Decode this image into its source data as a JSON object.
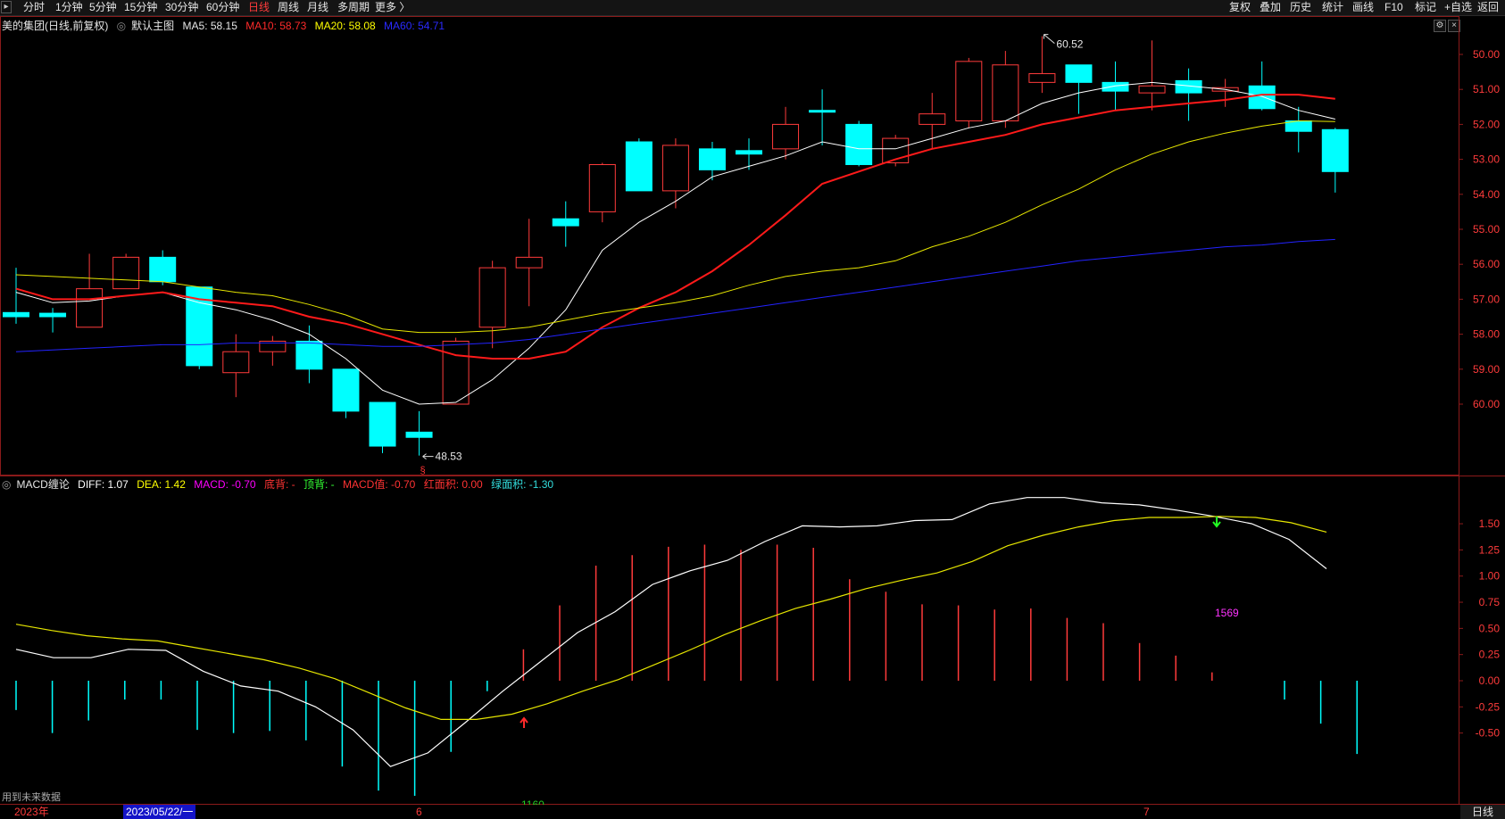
{
  "toolbar": {
    "left": [
      {
        "label": "分时",
        "active": false
      },
      {
        "label": "1分钟",
        "active": false
      },
      {
        "label": "5分钟",
        "active": false
      },
      {
        "label": "15分钟",
        "active": false
      },
      {
        "label": "30分钟",
        "active": false
      },
      {
        "label": "60分钟",
        "active": false
      },
      {
        "label": "日线",
        "active": true
      },
      {
        "label": "周线",
        "active": false
      },
      {
        "label": "月线",
        "active": false
      },
      {
        "label": "多周期",
        "active": false
      },
      {
        "label": "更多 〉",
        "active": false
      }
    ],
    "right": [
      "复权",
      "叠加",
      "历史",
      "统计",
      "画线",
      "F10",
      "标记",
      "+自选",
      "返回"
    ]
  },
  "main": {
    "title": "美的集团(日线,前复权)",
    "template": "默认主图",
    "ma5": "MA5: 58.15",
    "ma10": "MA10: 58.73",
    "ma20": "MA20: 58.08",
    "ma60": "MA60: 54.71",
    "high_label": "60.52",
    "low_label": "48.53",
    "low_marker": "§",
    "y_ticks": [
      "60.00",
      "59.00",
      "58.00",
      "57.00",
      "56.00",
      "55.00",
      "54.00",
      "53.00",
      "52.00",
      "51.00",
      "50.00"
    ]
  },
  "macd": {
    "name": "MACD缠论",
    "diff": "DIFF: 1.07",
    "dea": "DEA: 1.42",
    "macd": "MACD: -0.70",
    "bottom_div": "底背: -",
    "top_div": "顶背: -",
    "macd_value": "MACD值: -0.70",
    "red_area": "红面积: 0.00",
    "green_area": "绿面积: -1.30",
    "label_1569": "1569",
    "label_1160": "1160",
    "y_ticks": [
      "1.50",
      "1.25",
      "1.00",
      "0.75",
      "0.50",
      "0.25",
      "0.00",
      "-0.25",
      "-0.50"
    ]
  },
  "bottom": {
    "future_note": "用到未来数据",
    "year": "2023年",
    "cursor_date": "2023/05/22/一",
    "month6": "6",
    "month7": "7",
    "period_button": "日线"
  },
  "colors": {
    "up": "#ff3b3b",
    "down": "#00ffff",
    "ma5": "#ffffff",
    "ma10": "#ff1a1a",
    "ma20": "#e6e600",
    "ma60": "#2323ff",
    "diff": "#ffffff",
    "dea": "#e6e600"
  },
  "chart_data": [
    {
      "type": "candlestick",
      "title": "美的集团(日线,前复权)",
      "ylim": [
        49.5,
        60.6
      ],
      "y_ticks": [
        50,
        51,
        52,
        53,
        54,
        55,
        56,
        57,
        58,
        59,
        60
      ],
      "candles": [
        {
          "o": 52.62,
          "h": 53.9,
          "l": 52.3,
          "c": 52.5
        },
        {
          "o": 52.6,
          "h": 52.75,
          "l": 52.05,
          "c": 52.5
        },
        {
          "o": 52.2,
          "h": 54.3,
          "l": 52.2,
          "c": 53.3
        },
        {
          "o": 53.3,
          "h": 54.3,
          "l": 53.3,
          "c": 54.2
        },
        {
          "o": 54.2,
          "h": 54.4,
          "l": 53.4,
          "c": 53.5
        },
        {
          "o": 53.35,
          "h": 53.35,
          "l": 51.0,
          "c": 51.1
        },
        {
          "o": 50.9,
          "h": 52.0,
          "l": 50.2,
          "c": 51.5
        },
        {
          "o": 51.5,
          "h": 51.95,
          "l": 51.1,
          "c": 51.8
        },
        {
          "o": 51.8,
          "h": 52.25,
          "l": 50.6,
          "c": 51.0
        },
        {
          "o": 51.0,
          "h": 51.0,
          "l": 49.6,
          "c": 49.8
        },
        {
          "o": 50.05,
          "h": 50.05,
          "l": 48.6,
          "c": 48.8
        },
        {
          "o": 49.2,
          "h": 49.8,
          "l": 48.53,
          "c": 49.05
        },
        {
          "o": 50.0,
          "h": 51.9,
          "l": 50.0,
          "c": 51.8
        },
        {
          "o": 52.2,
          "h": 54.1,
          "l": 51.6,
          "c": 53.9
        },
        {
          "o": 53.9,
          "h": 55.3,
          "l": 52.8,
          "c": 54.2
        },
        {
          "o": 55.3,
          "h": 55.8,
          "l": 54.5,
          "c": 55.1
        },
        {
          "o": 55.5,
          "h": 56.9,
          "l": 55.2,
          "c": 56.85
        },
        {
          "o": 57.5,
          "h": 57.6,
          "l": 56.1,
          "c": 56.1
        },
        {
          "o": 56.1,
          "h": 57.6,
          "l": 55.6,
          "c": 57.4
        },
        {
          "o": 57.3,
          "h": 57.5,
          "l": 56.4,
          "c": 56.7
        },
        {
          "o": 57.25,
          "h": 57.6,
          "l": 56.7,
          "c": 57.15
        },
        {
          "o": 57.3,
          "h": 58.5,
          "l": 57.0,
          "c": 58.0
        },
        {
          "o": 58.4,
          "h": 59.0,
          "l": 57.4,
          "c": 58.35
        },
        {
          "o": 58.0,
          "h": 58.1,
          "l": 56.8,
          "c": 56.85
        },
        {
          "o": 56.9,
          "h": 57.7,
          "l": 56.8,
          "c": 57.6
        },
        {
          "o": 58.0,
          "h": 58.9,
          "l": 57.3,
          "c": 58.3
        },
        {
          "o": 58.1,
          "h": 59.9,
          "l": 57.9,
          "c": 59.8
        },
        {
          "o": 58.1,
          "h": 60.1,
          "l": 57.9,
          "c": 59.7
        },
        {
          "o": 59.2,
          "h": 60.52,
          "l": 58.9,
          "c": 59.45
        },
        {
          "o": 59.7,
          "h": 59.7,
          "l": 58.3,
          "c": 59.2
        },
        {
          "o": 59.2,
          "h": 59.8,
          "l": 58.4,
          "c": 58.95
        },
        {
          "o": 58.9,
          "h": 60.4,
          "l": 58.4,
          "c": 59.1
        },
        {
          "o": 59.25,
          "h": 59.6,
          "l": 58.1,
          "c": 58.9
        },
        {
          "o": 58.95,
          "h": 59.3,
          "l": 58.5,
          "c": 59.05
        },
        {
          "o": 59.1,
          "h": 59.8,
          "l": 58.4,
          "c": 58.45
        },
        {
          "o": 58.1,
          "h": 58.5,
          "l": 57.2,
          "c": 57.8
        },
        {
          "o": 57.85,
          "h": 57.9,
          "l": 56.05,
          "c": 56.65
        }
      ],
      "series": [
        {
          "name": "MA5",
          "values": [
            53.2,
            52.9,
            52.95,
            53.1,
            53.2,
            52.9,
            52.7,
            52.4,
            52.0,
            51.3,
            50.4,
            50.0,
            50.05,
            50.7,
            51.6,
            52.7,
            54.4,
            55.2,
            55.8,
            56.5,
            56.8,
            57.1,
            57.5,
            57.3,
            57.3,
            57.6,
            57.9,
            58.1,
            58.6,
            58.9,
            59.1,
            59.2,
            59.1,
            59.0,
            58.8,
            58.4,
            58.15
          ]
        },
        {
          "name": "MA10",
          "values": [
            53.3,
            53.0,
            53.0,
            53.1,
            53.2,
            53.0,
            52.9,
            52.8,
            52.5,
            52.3,
            52.0,
            51.7,
            51.4,
            51.3,
            51.3,
            51.5,
            52.2,
            52.75,
            53.2,
            53.8,
            54.55,
            55.4,
            56.3,
            56.65,
            57.0,
            57.3,
            57.5,
            57.7,
            58.0,
            58.2,
            58.4,
            58.5,
            58.6,
            58.7,
            58.85,
            58.85,
            58.73
          ]
        },
        {
          "name": "MA20",
          "values": [
            53.7,
            53.65,
            53.6,
            53.55,
            53.5,
            53.35,
            53.2,
            53.1,
            52.85,
            52.55,
            52.15,
            52.05,
            52.05,
            52.1,
            52.2,
            52.4,
            52.6,
            52.75,
            52.9,
            53.1,
            53.4,
            53.65,
            53.8,
            53.9,
            54.1,
            54.5,
            54.8,
            55.2,
            55.7,
            56.15,
            56.7,
            57.15,
            57.5,
            57.75,
            57.95,
            58.1,
            58.08
          ]
        },
        {
          "name": "MA60",
          "values": [
            51.5,
            51.55,
            51.6,
            51.65,
            51.7,
            51.7,
            51.75,
            51.75,
            51.75,
            51.7,
            51.65,
            51.65,
            51.7,
            51.75,
            51.85,
            52.0,
            52.15,
            52.3,
            52.45,
            52.6,
            52.75,
            52.9,
            53.05,
            53.2,
            53.35,
            53.5,
            53.65,
            53.8,
            53.95,
            54.1,
            54.2,
            54.3,
            54.4,
            54.5,
            54.55,
            54.65,
            54.71
          ]
        }
      ]
    },
    {
      "type": "bar",
      "title": "MACD缠论",
      "ylim": [
        -1.1,
        1.85
      ],
      "y_ticks": [
        1.5,
        1.25,
        1.0,
        0.75,
        0.5,
        0.25,
        0.0,
        -0.25,
        -0.5
      ],
      "values": [
        -0.28,
        -0.5,
        -0.38,
        -0.18,
        -0.18,
        -0.47,
        -0.5,
        -0.48,
        -0.57,
        -0.82,
        -1.05,
        -1.1,
        -0.68,
        -0.1,
        0.3,
        0.72,
        1.1,
        1.2,
        1.28,
        1.3,
        1.25,
        1.3,
        1.27,
        0.97,
        0.85,
        0.73,
        0.72,
        0.68,
        0.69,
        0.6,
        0.55,
        0.36,
        0.24,
        0.08,
        0.0,
        -0.18,
        -0.41,
        -0.7
      ],
      "series": [
        {
          "name": "DIFF",
          "values": [
            0.3,
            0.22,
            0.22,
            0.3,
            0.29,
            0.09,
            -0.05,
            -0.1,
            -0.25,
            -0.47,
            -0.82,
            -0.69,
            -0.4,
            -0.1,
            0.18,
            0.46,
            0.66,
            0.92,
            1.05,
            1.15,
            1.33,
            1.48,
            1.47,
            1.48,
            1.53,
            1.54,
            1.69,
            1.75,
            1.75,
            1.7,
            1.68,
            1.63,
            1.57,
            1.5,
            1.35,
            1.07
          ]
        },
        {
          "name": "DEA",
          "values": [
            0.54,
            0.48,
            0.43,
            0.4,
            0.38,
            0.32,
            0.26,
            0.2,
            0.12,
            0.02,
            -0.12,
            -0.26,
            -0.37,
            -0.37,
            -0.32,
            -0.22,
            -0.1,
            0.01,
            0.15,
            0.29,
            0.44,
            0.57,
            0.69,
            0.78,
            0.88,
            0.96,
            1.03,
            1.14,
            1.29,
            1.39,
            1.47,
            1.53,
            1.56,
            1.56,
            1.57,
            1.56,
            1.51,
            1.42
          ]
        }
      ]
    }
  ]
}
